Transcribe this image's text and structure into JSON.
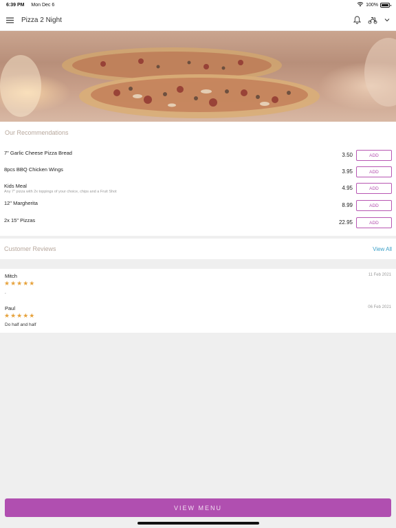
{
  "status_bar": {
    "time": "6:39 PM",
    "date": "Mon Dec 6",
    "battery": "100%",
    "battery_level": 1.0
  },
  "header": {
    "title": "Pizza 2 Night"
  },
  "recommendations": {
    "title": "Our Recommendations",
    "add_label": "ADD",
    "items": [
      {
        "name": "7\" Garlic Cheese Pizza Bread",
        "description": "",
        "price": "3.50"
      },
      {
        "name": "8pcs BBQ Chicken Wings",
        "description": "",
        "price": "3.95"
      },
      {
        "name": "Kids Meal",
        "description": "Any 7\" pizza with 2x toppings of your choice, chips and a Fruit Shot",
        "price": "4.95"
      },
      {
        "name": "12\" Margherita",
        "description": "",
        "price": "8.99"
      },
      {
        "name": "2x 15\" Pizzas",
        "description": "",
        "price": "22.95"
      }
    ]
  },
  "reviews": {
    "title": "Customer Reviews",
    "view_all": "View All",
    "items": [
      {
        "name": "Mitch",
        "date": "11 Feb 2021",
        "rating": 5,
        "stars": "★★★★★",
        "text": "."
      },
      {
        "name": "Paul",
        "date": "06 Feb 2021",
        "rating": 5,
        "stars": "★★★★★",
        "text": "Do half and half"
      }
    ]
  },
  "footer": {
    "view_menu": "VIEW MENU"
  },
  "colors": {
    "accent": "#b04fb0",
    "link": "#3a9fc7",
    "star": "#e6a23c",
    "section_title": "#b7a79c"
  }
}
